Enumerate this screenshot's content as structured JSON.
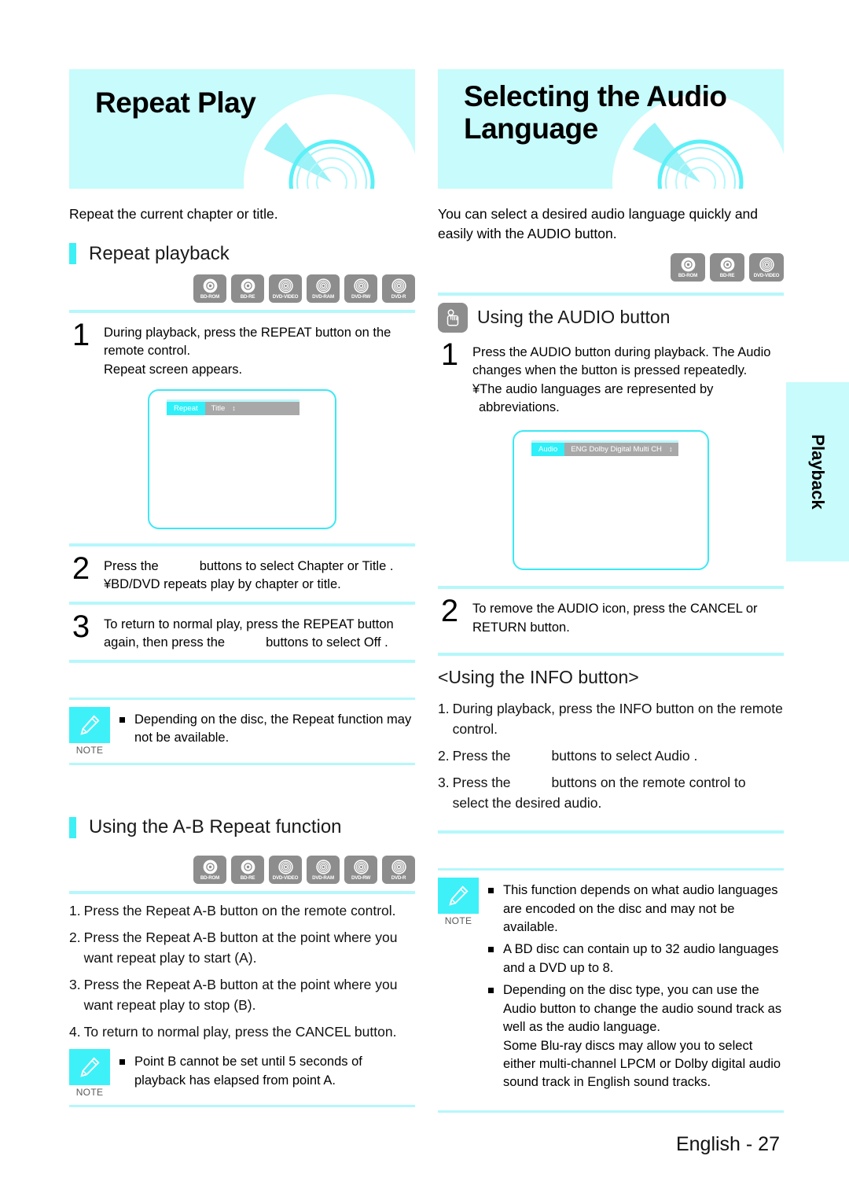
{
  "page": {
    "footer": "English - 27",
    "side_tab": "Playback",
    "accent_cyan": "#3df0f5",
    "banner_bg": "#c8fbfb",
    "badge_gray": "#8d8d8d"
  },
  "left": {
    "banner_title": "Repeat Play",
    "intro": "Repeat the current chapter or title.",
    "section_heading": "Repeat playback",
    "badges": [
      "BD-ROM",
      "BD-RE",
      "DVD-VIDEO",
      "DVD-RAM",
      "DVD-RW",
      "DVD-R"
    ],
    "steps": [
      {
        "num": "1",
        "lines": [
          "During playback, press the REPEAT button on the",
          "remote control.",
          "Repeat screen appears."
        ]
      }
    ],
    "osd": {
      "key": "Repeat",
      "value": "Title",
      "updown": "↕"
    },
    "step2": {
      "num": "2",
      "pre": "Press the",
      "mid": "buttons to select Chapter  or Title .",
      "line2": "¥BD/DVD repeats play by chapter or title."
    },
    "step3": {
      "num": "3",
      "line1": "To return to normal play, press the REPEAT  button",
      "pre2": "again, then press the",
      "post2": "buttons to select Off ."
    },
    "note1": {
      "label": "NOTE",
      "items": [
        "Depending on the disc, the Repeat function may not be available."
      ]
    },
    "ab_heading": "Using the A-B Repeat function",
    "ab_badges": [
      "BD-ROM",
      "BD-RE",
      "DVD-VIDEO",
      "DVD-RAM",
      "DVD-RW",
      "DVD-R"
    ],
    "ab_list": [
      {
        "n": "1.",
        "t": "Press the Repeat A-B  button on the remote control."
      },
      {
        "n": "2.",
        "t": "Press the Repeat A-B  button at the point where you want repeat play to start (A)."
      },
      {
        "n": "3.",
        "t": "Press the Repeat A-B  button at the point where you want repeat play to stop (B)."
      },
      {
        "n": "4.",
        "t": "To return to normal play, press the CANCEL  button."
      }
    ],
    "note2": {
      "label": "NOTE",
      "items": [
        "Point B cannot be set until 5 seconds of playback has elapsed from point A."
      ]
    }
  },
  "right": {
    "banner_title_line1": "Selecting the Audio",
    "banner_title_line2": "Language",
    "intro": "You can select a desired audio language quickly and easily with the AUDIO button.",
    "badges": [
      "BD-ROM",
      "BD-RE",
      "DVD-VIDEO"
    ],
    "audio_heading": "Using the AUDIO button",
    "step1": {
      "num": "1",
      "lines": [
        "Press the AUDIO button during playback. The Audio",
        "changes when the button is pressed repeatedly.",
        "¥The audio languages are represented by",
        "abbreviations."
      ]
    },
    "osd": {
      "key": "Audio",
      "value": "ENG Dolby Digital Multi CH",
      "updown": "↕"
    },
    "step2": {
      "num": "2",
      "lines": [
        "To remove the AUDIO icon, press the CANCEL  or",
        "RETURN button."
      ]
    },
    "info_heading": "<Using the INFO button>",
    "info_list": [
      {
        "n": "1.",
        "pre": "During playback, press the INFO button on the remote control.",
        "gap": false,
        "post": ""
      },
      {
        "n": "2.",
        "pre": "Press the",
        "gap": true,
        "post": "buttons to select Audio ."
      },
      {
        "n": "3.",
        "pre": "Press the",
        "gap": true,
        "post": "buttons on the remote control to select the desired audio."
      }
    ],
    "note": {
      "label": "NOTE",
      "items": [
        "This function depends on what audio languages are encoded on the disc and may not be available.",
        "A BD disc can contain up to 32 audio languages and a DVD up to 8.",
        "Depending on the disc type, you can use the Audio button to change the audio sound track as well as the audio language.\nSome Blu-ray discs may allow you to select either multi-channel LPCM or Dolby digital audio sound track in English sound tracks."
      ]
    }
  }
}
